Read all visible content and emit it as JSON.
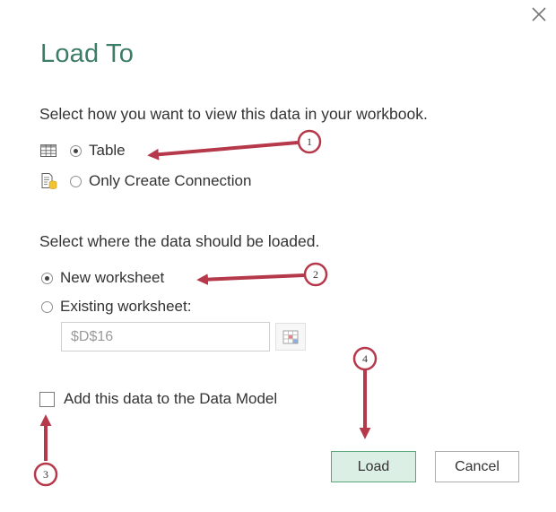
{
  "dialog": {
    "title": "Load To",
    "view_prompt": "Select how you want to view this data in your workbook.",
    "view_options": [
      {
        "label": "Table",
        "selected": true,
        "icon": "table-icon"
      },
      {
        "label": "Only Create Connection",
        "selected": false,
        "icon": "connection-icon"
      }
    ],
    "location_prompt": "Select where the data should be loaded.",
    "location_options": [
      {
        "label": "New worksheet",
        "selected": true
      },
      {
        "label": "Existing worksheet:",
        "selected": false
      }
    ],
    "range_value": "$D$16",
    "data_model_label": "Add this data to the Data Model",
    "data_model_checked": false,
    "load_label": "Load",
    "cancel_label": "Cancel",
    "close_icon": "close-icon"
  },
  "annotations": {
    "color": "#b5394a",
    "badges": [
      "1",
      "2",
      "3",
      "4"
    ]
  }
}
